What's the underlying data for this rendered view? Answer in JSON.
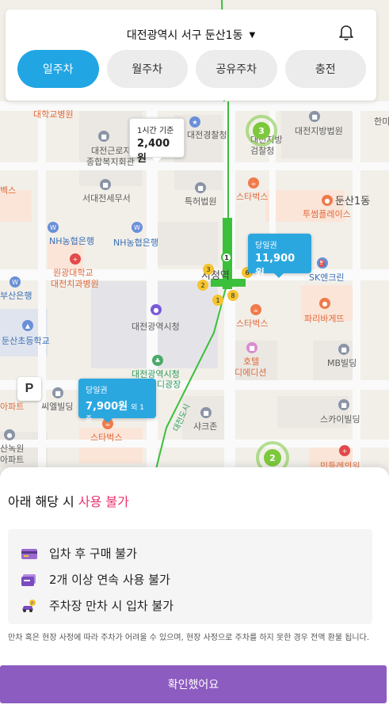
{
  "header": {
    "location": "대전광역시 서구 둔산1동",
    "tabs": [
      {
        "label": "일주차",
        "active": true
      },
      {
        "label": "월주차",
        "active": false
      },
      {
        "label": "공유주차",
        "active": false
      },
      {
        "label": "충전",
        "active": false
      }
    ]
  },
  "map": {
    "labels": {
      "l1": "대학교병원",
      "l2": "대전근로자",
      "l3": "종합복지회관",
      "l4": "대전경찰청",
      "l5": "대전지방",
      "l6": "검찰청",
      "l7": "대전지방법원",
      "l8": "한미",
      "l9": "벡스",
      "l10": "서대전세무서",
      "l11": "특허법원",
      "l12": "스타벅스",
      "l13": "둔산1동",
      "l14": "투썸플레이스",
      "l15": "NH농협은행",
      "l16": "NH농협은행",
      "l17": "원광대학교",
      "l18": "대전치과병원",
      "l19": "시청역",
      "l20": "SK엔크린",
      "l21": "부산은행",
      "l22": "대전광역시청",
      "l23": "스타벅스",
      "l24": "파리바게뜨",
      "l25": "둔산초등학교",
      "l26": "대전광역시청",
      "l27": "디광장",
      "l28": "호텔",
      "l29": "디에디션",
      "l30": "MB빌딩",
      "l31": "씨엘빌딩",
      "l32": "아파트",
      "l33": "샤크존",
      "l34": "스카이빌딩",
      "l35": "스타벅스",
      "l36": "산녹원",
      "l37": "아파트",
      "l38": "민들레의원",
      "l39": "대전도시"
    },
    "bubbles": [
      {
        "caption": "1시간 기준",
        "price": "2,400원",
        "extra": ""
      },
      {
        "caption": "당일권",
        "price": "11,900원",
        "extra": ""
      },
      {
        "caption": "당일권",
        "price": "7,900원",
        "extra": "외 1종"
      }
    ],
    "clusters": [
      "3",
      "2"
    ],
    "parking_marker": "P",
    "exit_numbers": [
      "1",
      "3",
      "2",
      "6",
      "1",
      "8"
    ],
    "colors": {
      "accent": "#21a6e3",
      "cluster": "#7cc93c",
      "subway": "#3cbf3c"
    }
  },
  "sheet": {
    "title_prefix": "아래 해당 시 ",
    "title_accent": "사용 불가",
    "rules": [
      {
        "icon": "credit-card-icon",
        "text": "입차 후 구매 불가"
      },
      {
        "icon": "ticket-icon",
        "text": "2개 이상 연속 사용 불가"
      },
      {
        "icon": "parked-car-icon",
        "text": "주차장 만차 시 입차 불가"
      }
    ],
    "notice": "만차 혹은 현장 사정에 따라 주차가 어려울 수 있으며, 현장 사정으로 주차를 하지 못한 경우 전액 환불 됩니다.",
    "confirm_label": "확인했어요"
  }
}
